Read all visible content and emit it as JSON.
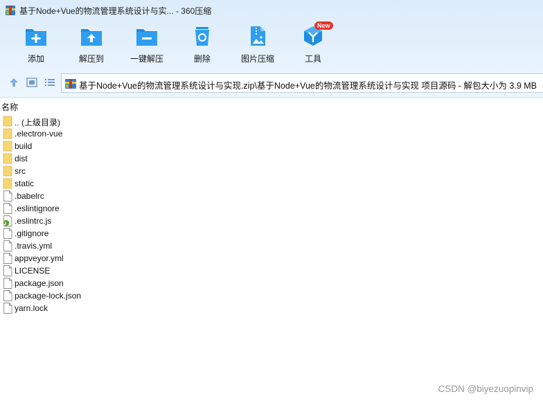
{
  "window": {
    "title": "基于Node+Vue的物流管理系统设计与实... - 360压缩"
  },
  "toolbar": {
    "items": [
      {
        "label": "添加",
        "icon": "add-icon"
      },
      {
        "label": "解压到",
        "icon": "extract-to-icon"
      },
      {
        "label": "一键解压",
        "icon": "one-click-extract-icon"
      },
      {
        "label": "删除",
        "icon": "delete-icon"
      },
      {
        "label": "图片压缩",
        "icon": "image-compress-icon"
      },
      {
        "label": "工具",
        "icon": "tools-icon"
      }
    ],
    "badge": "New"
  },
  "navbar": {
    "path": "基于Node+Vue的物流管理系统设计与实现.zip\\基于Node+Vue的物流管理系统设计与实现 项目源码 - 解包大小为 3.9 MB"
  },
  "list": {
    "column_name": "名称",
    "items": [
      {
        "name": ".. (上级目录)",
        "type": "folder"
      },
      {
        "name": ".electron-vue",
        "type": "folder"
      },
      {
        "name": "build",
        "type": "folder"
      },
      {
        "name": "dist",
        "type": "folder"
      },
      {
        "name": "src",
        "type": "folder"
      },
      {
        "name": "static",
        "type": "folder"
      },
      {
        "name": ".babelrc",
        "type": "file"
      },
      {
        "name": ".eslintignore",
        "type": "file"
      },
      {
        "name": ".eslintrc.js",
        "type": "js"
      },
      {
        "name": ".gitignore",
        "type": "file"
      },
      {
        "name": ".travis.yml",
        "type": "file"
      },
      {
        "name": "appveyor.yml",
        "type": "file"
      },
      {
        "name": "LICENSE",
        "type": "file"
      },
      {
        "name": "package.json",
        "type": "file"
      },
      {
        "name": "package-lock.json",
        "type": "file"
      },
      {
        "name": "yarn.lock",
        "type": "file"
      }
    ]
  },
  "watermark": "CSDN @biyezuopinvip",
  "colors": {
    "accent": "#1e8fe0",
    "badge": "#e8332a",
    "folder": "#f7d774"
  }
}
